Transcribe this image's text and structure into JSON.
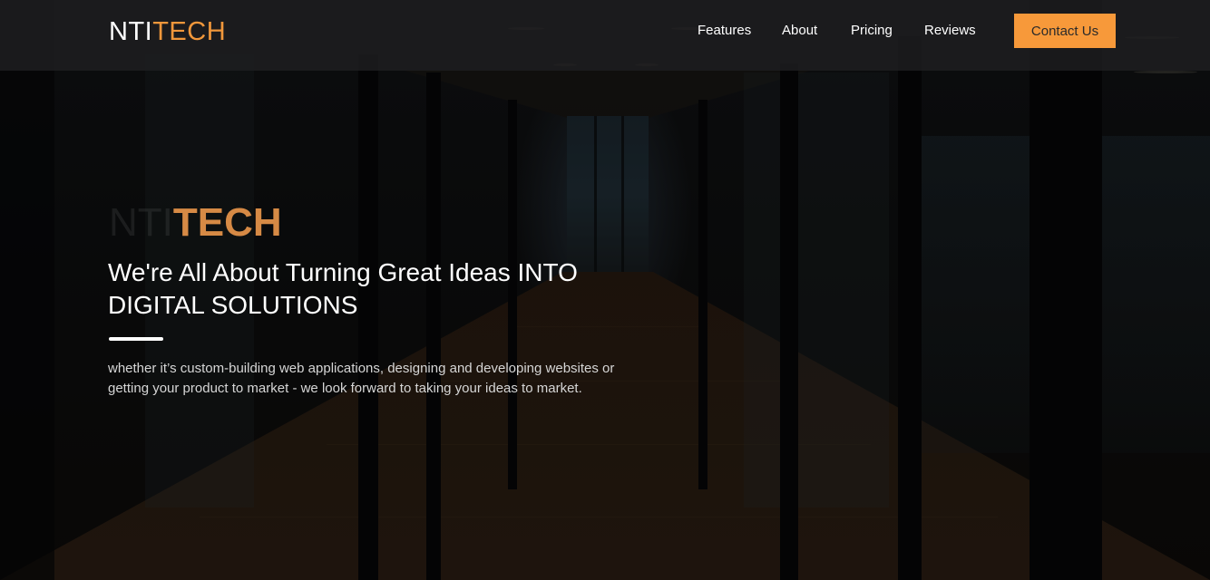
{
  "navbar": {
    "brand_prefix": "NTI",
    "brand_accent": "TECH",
    "links": [
      {
        "label": "Features"
      },
      {
        "label": "About"
      },
      {
        "label": "Pricing"
      },
      {
        "label": "Reviews"
      }
    ],
    "contact_label": "Contact Us"
  },
  "hero": {
    "brand_prefix": "NTI",
    "brand_accent": "TECH",
    "title": "We're All About Turning Great Ideas INTO DIGITAL SOLUTIONS",
    "description": "whether it’s custom-building web applications, designing and developing websites or getting your product to market - we look forward to taking your ideas to market."
  },
  "colors": {
    "accent": "#f7993a",
    "navbar_bg": "#1e1f21",
    "text": "#ffffff"
  },
  "background": {
    "image_subject": "office-corridor-photo"
  }
}
